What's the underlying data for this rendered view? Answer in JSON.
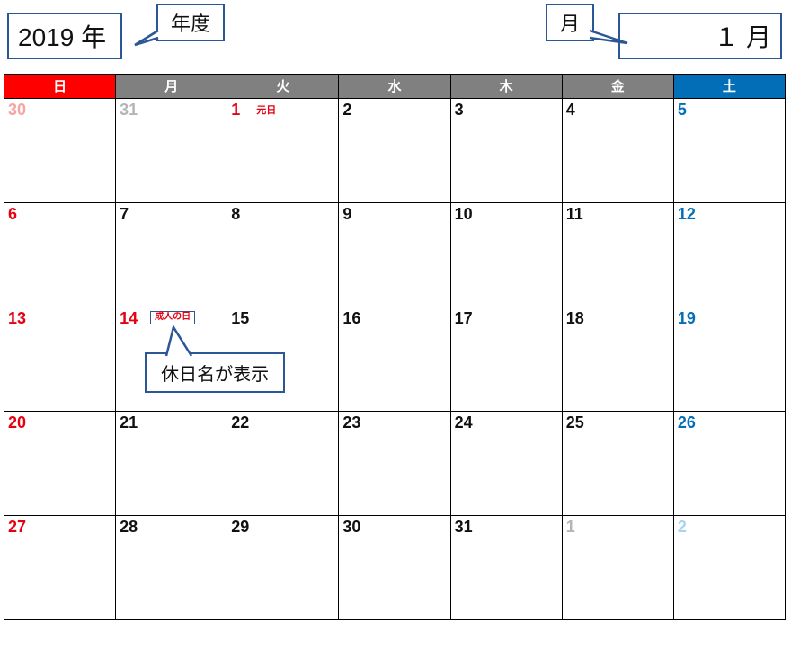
{
  "header": {
    "year_text": "2019 年",
    "month_text": "１ 月",
    "callout_year_label": "年度",
    "callout_month_label": "月",
    "callout_holiday_label": "休日名が表示"
  },
  "weekdays": [
    "日",
    "月",
    "火",
    "水",
    "木",
    "金",
    "土"
  ],
  "holiday_names": {
    "gantan": "元日",
    "seijin": "成人の日"
  },
  "weeks": [
    [
      {
        "n": "30",
        "cls": "sun other"
      },
      {
        "n": "31",
        "cls": "other"
      },
      {
        "n": "1",
        "cls": "holiday",
        "hol": "gantan",
        "plain": true
      },
      {
        "n": "2",
        "cls": ""
      },
      {
        "n": "3",
        "cls": ""
      },
      {
        "n": "4",
        "cls": ""
      },
      {
        "n": "5",
        "cls": "sat"
      }
    ],
    [
      {
        "n": "6",
        "cls": "sun"
      },
      {
        "n": "7",
        "cls": ""
      },
      {
        "n": "8",
        "cls": ""
      },
      {
        "n": "9",
        "cls": ""
      },
      {
        "n": "10",
        "cls": ""
      },
      {
        "n": "11",
        "cls": ""
      },
      {
        "n": "12",
        "cls": "sat"
      }
    ],
    [
      {
        "n": "13",
        "cls": "sun"
      },
      {
        "n": "14",
        "cls": "holiday",
        "hol": "seijin",
        "boxed": true,
        "callout": true
      },
      {
        "n": "15",
        "cls": ""
      },
      {
        "n": "16",
        "cls": ""
      },
      {
        "n": "17",
        "cls": ""
      },
      {
        "n": "18",
        "cls": ""
      },
      {
        "n": "19",
        "cls": "sat"
      }
    ],
    [
      {
        "n": "20",
        "cls": "sun"
      },
      {
        "n": "21",
        "cls": ""
      },
      {
        "n": "22",
        "cls": ""
      },
      {
        "n": "23",
        "cls": ""
      },
      {
        "n": "24",
        "cls": ""
      },
      {
        "n": "25",
        "cls": ""
      },
      {
        "n": "26",
        "cls": "sat"
      }
    ],
    [
      {
        "n": "27",
        "cls": "sun"
      },
      {
        "n": "28",
        "cls": ""
      },
      {
        "n": "29",
        "cls": ""
      },
      {
        "n": "30",
        "cls": ""
      },
      {
        "n": "31",
        "cls": ""
      },
      {
        "n": "1",
        "cls": "other"
      },
      {
        "n": "2",
        "cls": "sat other"
      }
    ]
  ]
}
